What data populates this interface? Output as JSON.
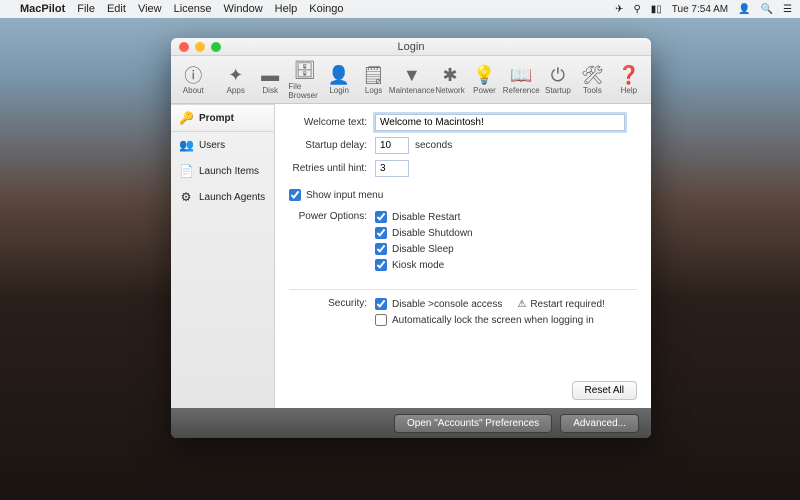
{
  "menubar": {
    "app": "MacPilot",
    "items": [
      "File",
      "Edit",
      "View",
      "License",
      "Window",
      "Help",
      "Koingo"
    ],
    "time": "Tue 7:54 AM"
  },
  "window": {
    "title": "Login"
  },
  "toolbar": {
    "about": "About",
    "apps": "Apps",
    "disk": "Disk",
    "file_browser": "File Browser",
    "login": "Login",
    "logs": "Logs",
    "maintenance": "Maintenance",
    "network": "Network",
    "power": "Power",
    "reference": "Reference",
    "startup": "Startup",
    "tools": "Tools",
    "help": "Help"
  },
  "sidebar": {
    "items": [
      {
        "icon": "🔑",
        "label": "Prompt"
      },
      {
        "icon": "👥",
        "label": "Users"
      },
      {
        "icon": "📄",
        "label": "Launch Items"
      },
      {
        "icon": "⚙",
        "label": "Launch Agents"
      }
    ]
  },
  "form": {
    "welcome_label": "Welcome text:",
    "welcome_value": "Welcome to Macintosh!",
    "startup_label": "Startup delay:",
    "startup_value": "10",
    "seconds": "seconds",
    "retries_label": "Retries until hint:",
    "retries_value": "3",
    "show_input_menu": "Show input menu",
    "power_label": "Power Options:",
    "power": {
      "disable_restart": "Disable Restart",
      "disable_shutdown": "Disable Shutdown",
      "disable_sleep": "Disable Sleep",
      "kiosk": "Kiosk mode"
    },
    "security_label": "Security:",
    "security": {
      "disable_console": "Disable >console access",
      "restart_required": "Restart required!",
      "auto_lock": "Automatically lock the screen when logging in"
    },
    "reset": "Reset All"
  },
  "footer": {
    "open_accounts": "Open \"Accounts\" Preferences",
    "advanced": "Advanced..."
  }
}
